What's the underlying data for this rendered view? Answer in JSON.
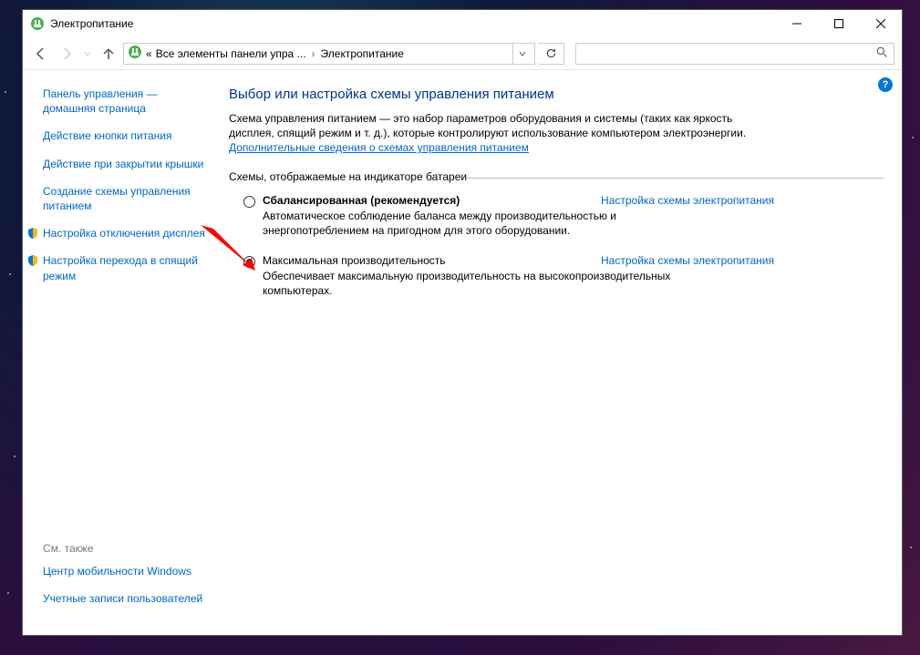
{
  "window": {
    "title": "Электропитание"
  },
  "breadcrumb": {
    "prefix": "«",
    "part1": "Все элементы панели упра ...",
    "part2": "Электропитание"
  },
  "search": {
    "placeholder": ""
  },
  "sidebar": {
    "home": "Панель управления — домашняя страница",
    "links": [
      "Действие кнопки питания",
      "Действие при закрытии крышки",
      "Создание схемы управления питанием",
      "Настройка отключения дисплея",
      "Настройка перехода в спящий режим"
    ],
    "see_also_hdr": "См. также",
    "see_also": [
      "Центр мобильности Windows",
      "Учетные записи пользователей"
    ]
  },
  "main": {
    "heading": "Выбор или настройка схемы управления питанием",
    "description": "Схема управления питанием — это набор параметров оборудования и системы (таких как яркость дисплея, спящий режим и т. д.), которые контролируют использование компьютером электроэнергии.",
    "info_link": "Дополнительные сведения о схемах управления питанием",
    "group_label": "Схемы, отображаемые на индикаторе батареи",
    "schemes": [
      {
        "name": "Сбалансированная (рекомендуется)",
        "desc": "Автоматическое соблюдение баланса между производительностью и энергопотреблением на пригодном для этого оборудовании.",
        "settings_link": "Настройка схемы электропитания",
        "selected": false
      },
      {
        "name": "Максимальная производительность",
        "desc": "Обеспечивает максимальную производительность на высокопроизводительных компьютерах.",
        "settings_link": "Настройка схемы электропитания",
        "selected": true
      }
    ]
  }
}
